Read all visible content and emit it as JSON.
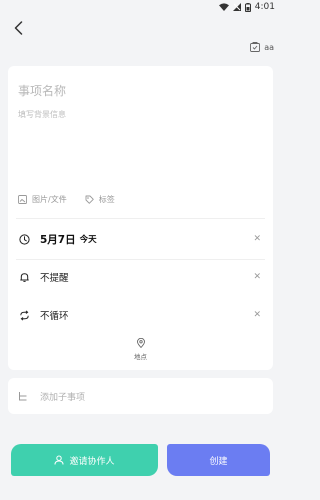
{
  "status_bar": {
    "time": "4:01"
  },
  "header": {
    "template_label": "aa"
  },
  "form": {
    "title_placeholder": "事项名称",
    "description_placeholder": "填写背景信息",
    "attachments": {
      "media_label": "图片/文件",
      "tag_label": "标签"
    },
    "date": {
      "value": "5月7日",
      "relative": "今天"
    },
    "reminder_label": "不提醒",
    "repeat_label": "不循环",
    "location_label": "地点",
    "subtask_placeholder": "添加子事项"
  },
  "actions": {
    "invite_label": "邀请协作人",
    "create_label": "创建"
  },
  "colors": {
    "invite_button": "#3fd0ae",
    "create_button": "#6b7df2",
    "background": "#f3f4f6"
  },
  "icons": {
    "back": "chevron-left-icon",
    "template": "template-icon",
    "media": "image-icon",
    "tag": "tag-icon",
    "clock": "clock-icon",
    "bell": "bell-icon",
    "repeat": "repeat-icon",
    "location": "location-pin-icon",
    "subtask": "subtask-icon",
    "person": "person-icon"
  }
}
